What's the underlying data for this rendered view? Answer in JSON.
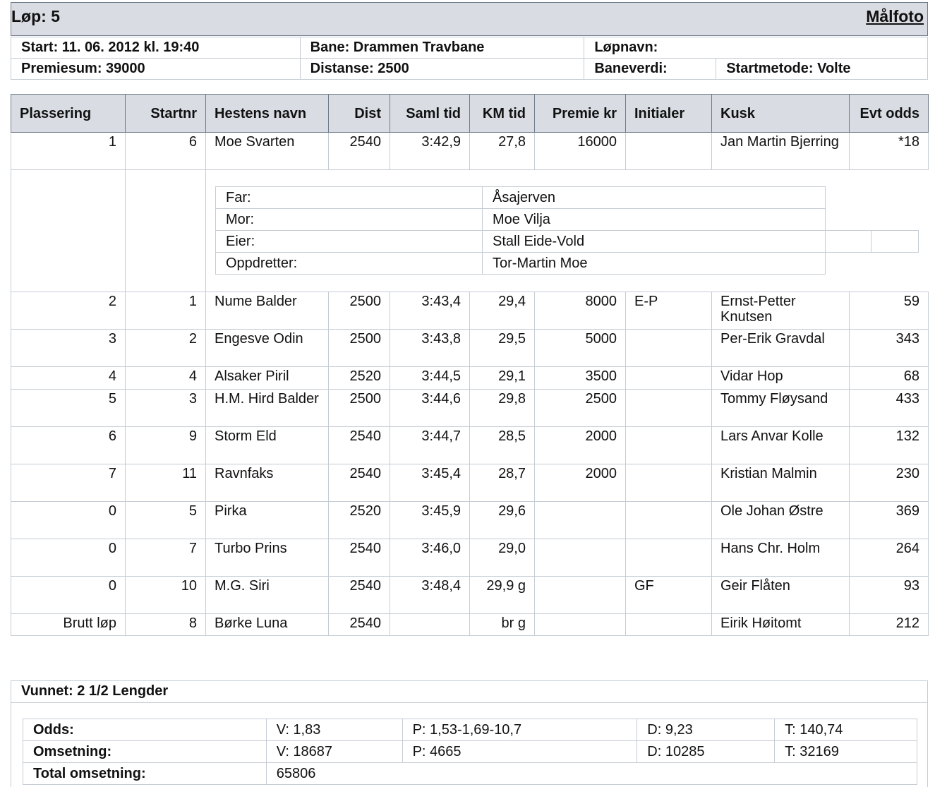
{
  "header": {
    "race": "Løp: 5",
    "photo_link": "Målfoto"
  },
  "info": {
    "start": "Start: 11. 06. 2012 kl. 19:40",
    "bane": "Bane: Drammen Travbane",
    "lopnavn": "Løpnavn:",
    "premiesum": "Premiesum: 39000",
    "distanse": "Distanse: 2500",
    "baneverdi": "Baneverdi:",
    "startmetode": "Startmetode: Volte"
  },
  "columns": {
    "plassering": "Plassering",
    "startnr": "Startnr",
    "navn": "Hestens navn",
    "dist": "Dist",
    "samltid": "Saml tid",
    "kmtid": "KM tid",
    "premie": "Premie kr",
    "initialer": "Initialer",
    "kusk": "Kusk",
    "odds": "Evt odds"
  },
  "rows": [
    {
      "place": "1",
      "startnr": "6",
      "name": "Moe Svarten",
      "dist": "2540",
      "saml": "3:42,9",
      "km": "27,8",
      "premie": "16000",
      "init": "",
      "kusk": "Jan Martin Bjerring",
      "odds": "*18"
    },
    {
      "place": "2",
      "startnr": "1",
      "name": "Nume Balder",
      "dist": "2500",
      "saml": "3:43,4",
      "km": "29,4",
      "premie": "8000",
      "init": "E-P",
      "kusk": "Ernst-Petter Knutsen",
      "odds": "59"
    },
    {
      "place": "3",
      "startnr": "2",
      "name": "Engesve Odin",
      "dist": "2500",
      "saml": "3:43,8",
      "km": "29,5",
      "premie": "5000",
      "init": "",
      "kusk": "Per-Erik Gravdal",
      "odds": "343"
    },
    {
      "place": "4",
      "startnr": "4",
      "name": "Alsaker Piril",
      "dist": "2520",
      "saml": "3:44,5",
      "km": "29,1",
      "premie": "3500",
      "init": "",
      "kusk": "Vidar Hop",
      "odds": "68"
    },
    {
      "place": "5",
      "startnr": "3",
      "name": "H.M. Hird Balder",
      "dist": "2500",
      "saml": "3:44,6",
      "km": "29,8",
      "premie": "2500",
      "init": "",
      "kusk": "Tommy Fløysand",
      "odds": "433"
    },
    {
      "place": "6",
      "startnr": "9",
      "name": "Storm Eld",
      "dist": "2540",
      "saml": "3:44,7",
      "km": "28,5",
      "premie": "2000",
      "init": "",
      "kusk": "Lars Anvar Kolle",
      "odds": "132"
    },
    {
      "place": "7",
      "startnr": "11",
      "name": "Ravnfaks",
      "dist": "2540",
      "saml": "3:45,4",
      "km": "28,7",
      "premie": "2000",
      "init": "",
      "kusk": "Kristian Malmin",
      "odds": "230"
    },
    {
      "place": "0",
      "startnr": "5",
      "name": "Pirka",
      "dist": "2520",
      "saml": "3:45,9",
      "km": "29,6",
      "premie": "",
      "init": "",
      "kusk": "Ole Johan Østre",
      "odds": "369"
    },
    {
      "place": "0",
      "startnr": "7",
      "name": "Turbo Prins",
      "dist": "2540",
      "saml": "3:46,0",
      "km": "29,0",
      "premie": "",
      "init": "",
      "kusk": "Hans Chr. Holm",
      "odds": "264"
    },
    {
      "place": "0",
      "startnr": "10",
      "name": "M.G. Siri",
      "dist": "2540",
      "saml": "3:48,4",
      "km": "29,9 g",
      "premie": "",
      "init": "GF",
      "kusk": "Geir Flåten",
      "odds": "93"
    },
    {
      "place": "Brutt løp",
      "startnr": "8",
      "name": "Børke Luna",
      "dist": "2540",
      "saml": "",
      "km": "br g",
      "premie": "",
      "init": "",
      "kusk": "Eirik Høitomt",
      "odds": "212"
    }
  ],
  "pedigree": [
    {
      "label": "Far:",
      "value": "Åsajerven"
    },
    {
      "label": "Mor:",
      "value": "Moe Vilja"
    },
    {
      "label": "Eier:",
      "value": "Stall Eide-Vold"
    },
    {
      "label": "Oppdretter:",
      "value": "Tor-Martin Moe"
    }
  ],
  "summary": {
    "vunnet": "Vunnet: 2 1/2 Lengder",
    "odds_label": "Odds:",
    "odds_v": "V: 1,83",
    "odds_p": "P: 1,53-1,69-10,7",
    "odds_d": "D: 9,23",
    "odds_t": "T: 140,74",
    "oms_label": "Omsetning:",
    "oms_v": "V: 18687",
    "oms_p": "P: 4665",
    "oms_d": "D: 10285",
    "oms_t": "T: 32169",
    "total_label": "Total omsetning:",
    "total_value": "65806"
  }
}
